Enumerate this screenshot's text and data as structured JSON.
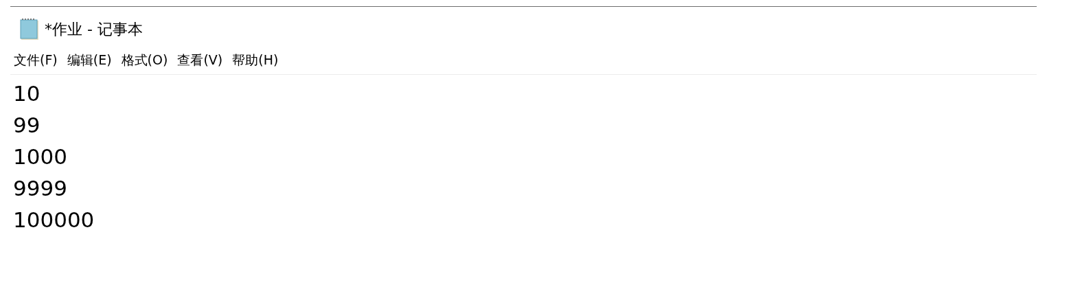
{
  "window": {
    "title": "*作业 - 记事本"
  },
  "menu": [
    "文件(F)",
    "编辑(E)",
    "格式(O)",
    "查看(V)",
    "帮助(H)"
  ],
  "editor": {
    "lines": [
      "10",
      "99",
      "1000",
      "9999",
      "100000"
    ]
  }
}
